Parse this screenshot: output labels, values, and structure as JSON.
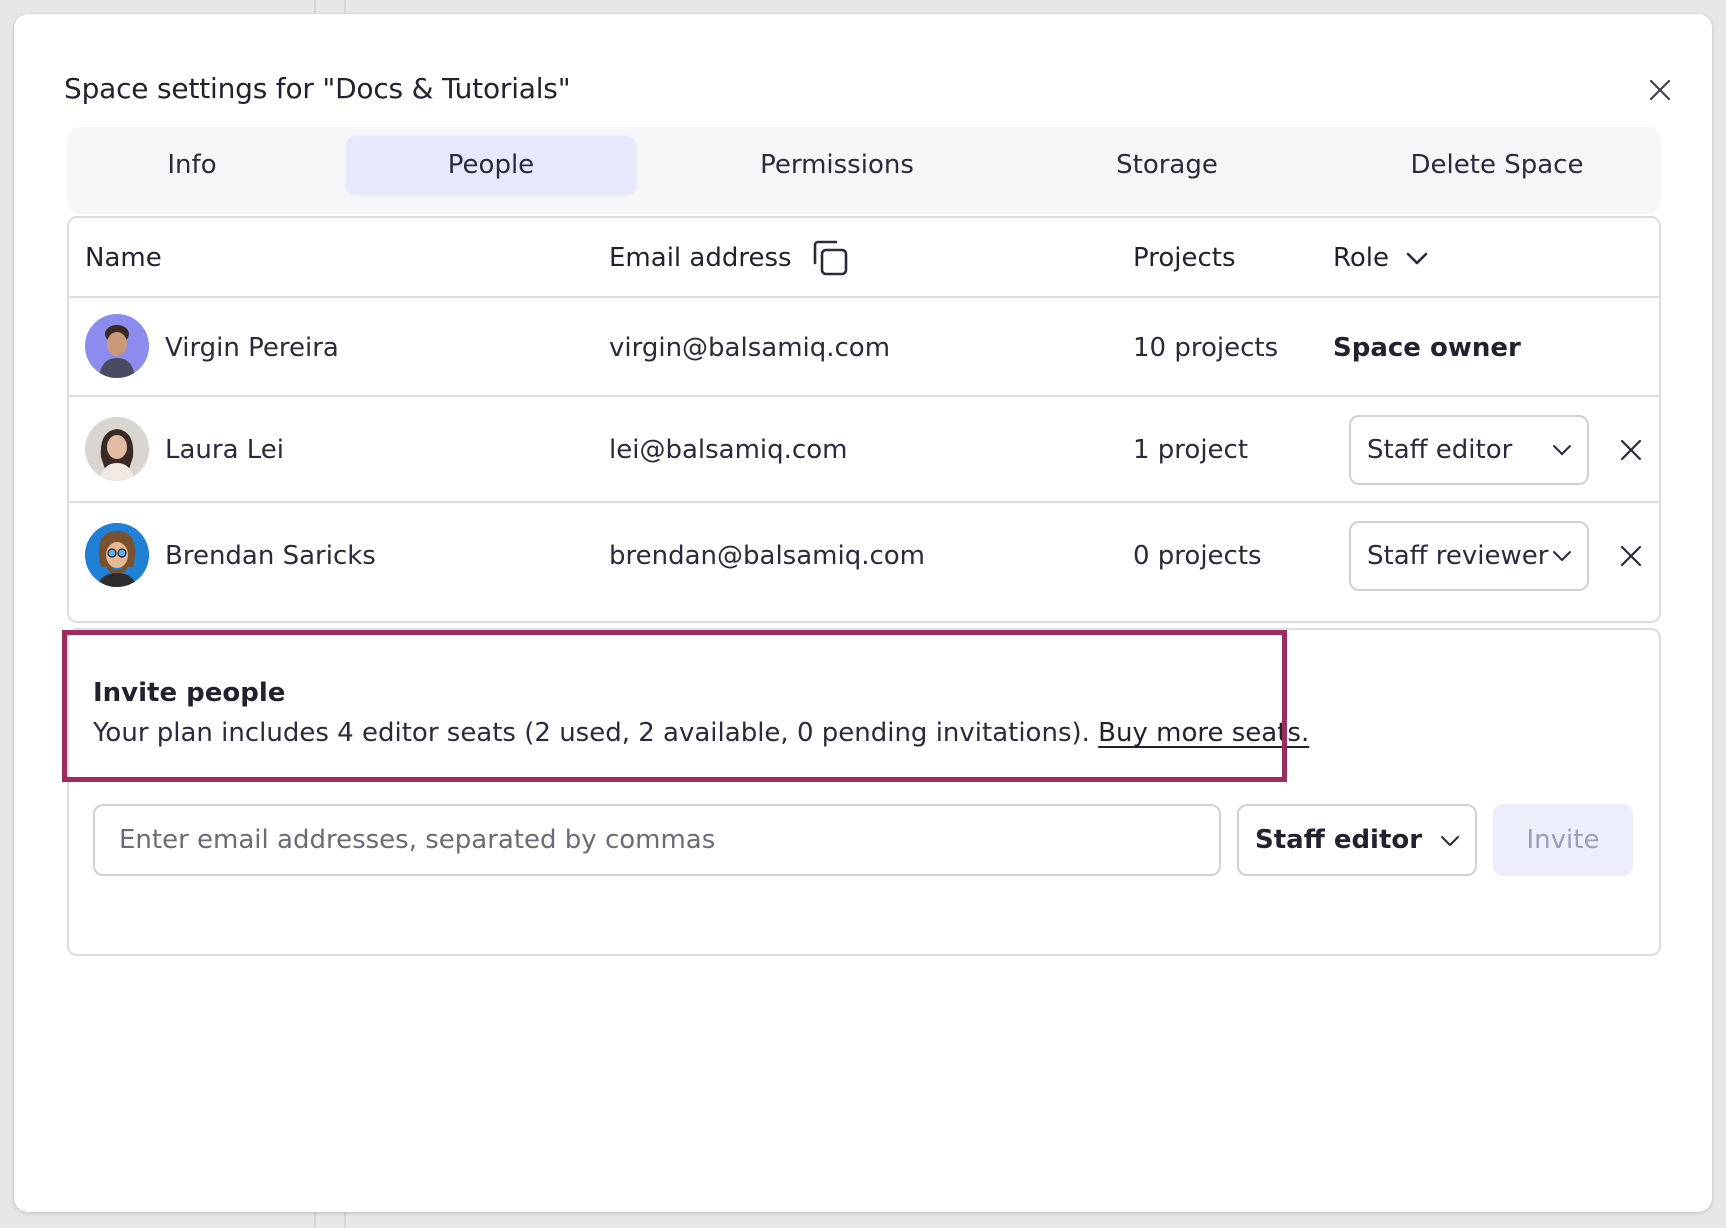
{
  "dialog": {
    "title": "Space settings for \"Docs & Tutorials\""
  },
  "tabs": [
    {
      "label": "Info",
      "active": false
    },
    {
      "label": "People",
      "active": true
    },
    {
      "label": "Permissions",
      "active": false
    },
    {
      "label": "Storage",
      "active": false
    },
    {
      "label": "Delete Space",
      "active": false
    }
  ],
  "table": {
    "headers": {
      "name": "Name",
      "email": "Email address",
      "projects": "Projects",
      "role": "Role"
    },
    "rows": [
      {
        "name": "Virgin Pereira",
        "email": "virgin@balsamiq.com",
        "projects": "10 projects",
        "role": "Space owner"
      },
      {
        "name": "Laura Lei",
        "email": "lei@balsamiq.com",
        "projects": "1 project",
        "role": "Staff editor"
      },
      {
        "name": "Brendan Saricks",
        "email": "brendan@balsamiq.com",
        "projects": "0 projects",
        "role": "Staff reviewer"
      }
    ]
  },
  "invite": {
    "title": "Invite people",
    "description": "Your plan includes 4 editor seats (2 used, 2 available, 0 pending invitations).",
    "buy_link": "Buy more seats.",
    "email_placeholder": "Enter email addresses, separated by commas",
    "role": "Staff editor",
    "button": "Invite"
  },
  "colors": {
    "highlight": "#9e2a5e",
    "active_tab": "#e6e8fb",
    "invite_button_bg": "#eceefb"
  }
}
